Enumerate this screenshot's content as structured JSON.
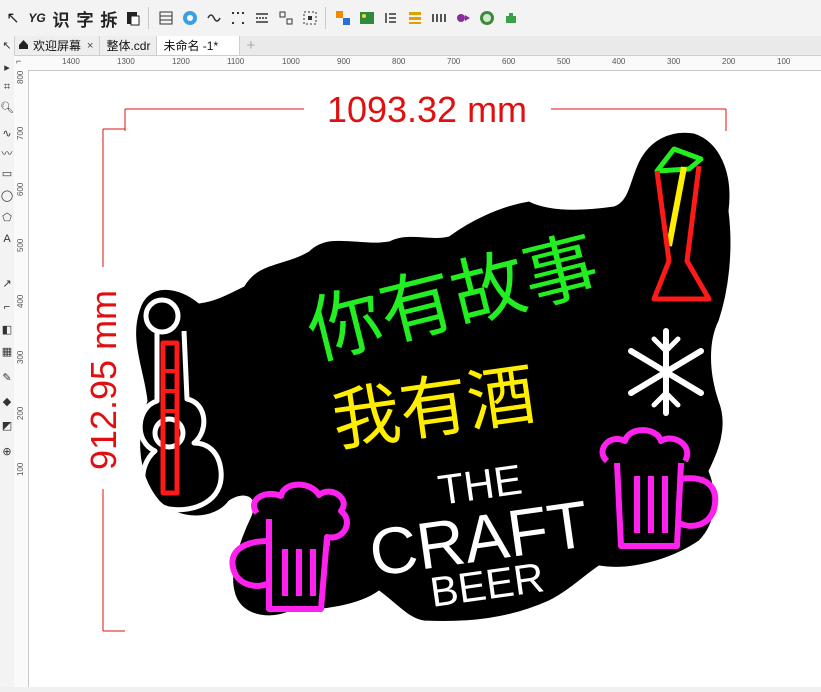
{
  "toolbar": {
    "items": [
      {
        "name": "yg-plugin-button",
        "label": "YG"
      },
      {
        "name": "identify-button",
        "label": "识"
      },
      {
        "name": "text-button",
        "label": "字"
      },
      {
        "name": "split-button",
        "label": "拆"
      }
    ]
  },
  "tabs": [
    {
      "label": "欢迎屏幕",
      "close": "×",
      "active": false
    },
    {
      "label": "整体.cdr",
      "close": "",
      "active": false
    },
    {
      "label": "未命名 -1*",
      "close": "",
      "active": true
    }
  ],
  "tab_add": "+",
  "hruler": [
    "1400",
    "1300",
    "1200",
    "1100",
    "1000",
    "900",
    "800",
    "700",
    "600",
    "500",
    "400",
    "300",
    "200",
    "100"
  ],
  "vruler": [
    "800",
    "700",
    "600",
    "500",
    "400",
    "300",
    "200",
    "100"
  ],
  "design": {
    "width_dim": "1093.32 mm",
    "height_dim": "912.95 mm",
    "line1": "你有故事",
    "line2": "我有酒",
    "craft_the": "THE",
    "craft_main": "CRAFT",
    "craft_beer": "BEER",
    "colors": {
      "dimension": "#e01010",
      "green": "#22ee22",
      "yellow": "#ffee00",
      "magenta": "#ff22ee",
      "red": "#ff1a1a",
      "white": "#ffffff",
      "board": "#000000"
    }
  }
}
